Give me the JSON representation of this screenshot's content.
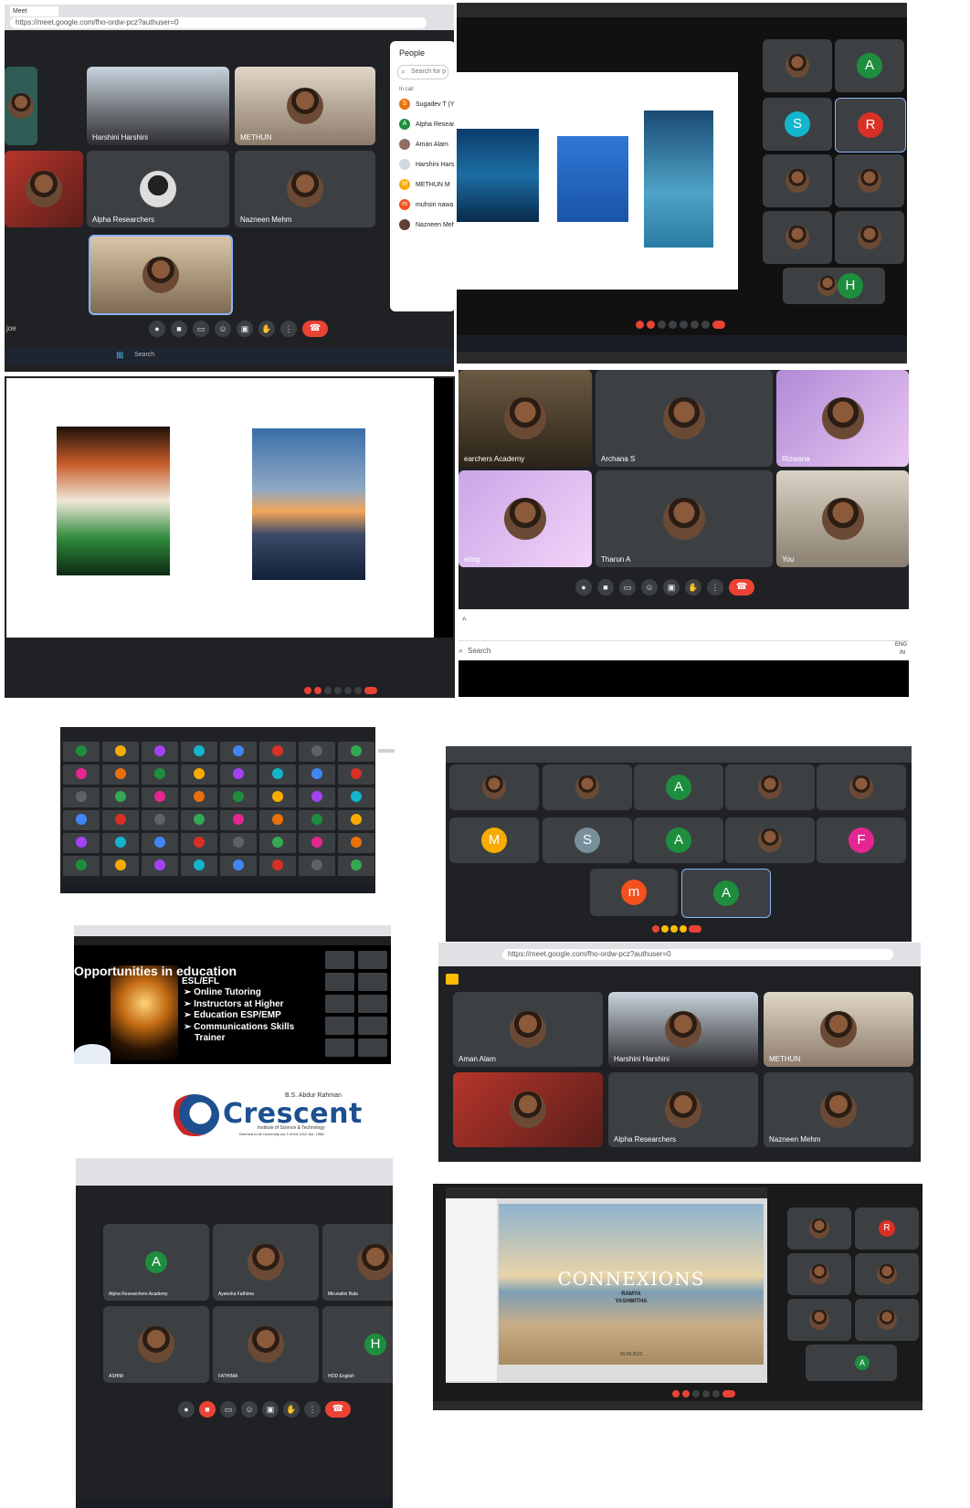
{
  "p1": {
    "tab": "Meet",
    "url": "https://meet.google.com/fho-ordw-pcz?authuser=0",
    "tiles": [
      {
        "name": ""
      },
      {
        "name": "Harshini Harshini"
      },
      {
        "name": "METHUN"
      },
      {
        "name": ""
      },
      {
        "name": "Alpha Researchers"
      },
      {
        "name": "Nazneen Mehm"
      },
      {
        "name": ""
      }
    ],
    "people": {
      "title": "People",
      "search": "Search for p",
      "in_call": "In call",
      "list": [
        {
          "initial": "S",
          "name": "Sugadev T (Y",
          "color": "#e8710a"
        },
        {
          "initial": "A",
          "name": "Alpha Resear",
          "color": "#1e8e3e"
        },
        {
          "initial": "",
          "name": "Aman Alam",
          "color": "#8d6e63"
        },
        {
          "initial": "",
          "name": "Harshini Hars",
          "color": "#cfd8dc"
        },
        {
          "initial": "M",
          "name": "METHUN M",
          "color": "#f9ab00"
        },
        {
          "initial": "m",
          "name": "muhsin nawa",
          "color": "#f4511e"
        },
        {
          "initial": "",
          "name": "Nazneen Meh",
          "color": "#5d4037"
        }
      ]
    },
    "bottom_left": "joe",
    "taskbar_search": "Search"
  },
  "p2": {
    "tiles": [
      {
        "name": "",
        "avatar": "",
        "color": ""
      },
      {
        "name": "",
        "avatar": "A",
        "color": "#1e8e3e"
      },
      {
        "name": "",
        "avatar": "S",
        "color": "#12b5cb"
      },
      {
        "name": "",
        "avatar": "R",
        "color": "#d93025"
      },
      {
        "name": "",
        "avatar": "",
        "color": ""
      },
      {
        "name": "",
        "avatar": "",
        "color": ""
      },
      {
        "name": "",
        "avatar": "",
        "color": ""
      },
      {
        "name": "",
        "avatar": "",
        "color": ""
      }
    ],
    "bottom_tile_avatar": "H"
  },
  "p3": {},
  "p4": {
    "tiles": [
      {
        "name": "earchers Academy"
      },
      {
        "name": "Archana S"
      },
      {
        "name": "Rizwana"
      },
      {
        "name": "eting"
      },
      {
        "name": "Tharun A"
      },
      {
        "name": "You"
      }
    ],
    "taskbar_search": "Search",
    "lang": "ENG",
    "lang2": "IN"
  },
  "p5": {},
  "p6": {
    "row1": [
      {
        "avatar": "",
        "color": ""
      },
      {
        "avatar": "",
        "color": ""
      },
      {
        "avatar": "A",
        "color": "#1e8e3e"
      },
      {
        "avatar": "",
        "color": ""
      },
      {
        "avatar": "",
        "color": ""
      }
    ],
    "row2": [
      {
        "avatar": "M",
        "color": "#f9ab00"
      },
      {
        "avatar": "S",
        "color": "#78909c"
      },
      {
        "avatar": "A",
        "color": "#1e8e3e"
      },
      {
        "avatar": "",
        "color": ""
      },
      {
        "avatar": "F",
        "color": "#e52592"
      }
    ],
    "row3": [
      {
        "avatar": "m",
        "color": "#f4511e"
      },
      {
        "avatar": "A",
        "color": "#1e8e3e"
      }
    ]
  },
  "p7": {
    "heading": "Opportunities in education",
    "sub": "ESL/EFL",
    "bullets": [
      "Online Tutoring",
      "Instructors at Higher",
      "Education ESP/EMP",
      "Communications Skills",
      "Trainer"
    ]
  },
  "logo": {
    "top": "B.S. Abdur Rahman",
    "name": "Crescent",
    "tagline": "Institute of Science & Technology",
    "tagline2": "Deemed to be University u/s 3 of the UGC Act, 1956"
  },
  "p8": {
    "url": "https://meet.google.com/fho-ordw-pcz?authuser=0",
    "tiles": [
      {
        "name": "Aman Alam"
      },
      {
        "name": "Harshini Harshini"
      },
      {
        "name": "METHUN"
      },
      {
        "name": ""
      },
      {
        "name": "Alpha Researchers"
      },
      {
        "name": "Nazneen Mehm"
      }
    ]
  },
  "p9": {
    "tiles": [
      {
        "name": "Alpha Researchers Academy",
        "avatar": "A",
        "color": "#1e8e3e"
      },
      {
        "name": "Ayeesha Fathima",
        "avatar": "",
        "color": ""
      },
      {
        "name": "Mirunalini Bala",
        "avatar": "",
        "color": ""
      },
      {
        "name": "ASHIM",
        "avatar": "",
        "color": ""
      },
      {
        "name": "FATHIMA",
        "avatar": "",
        "color": ""
      },
      {
        "name": "HOD English",
        "avatar": "H",
        "color": "#1e8e3e"
      }
    ]
  },
  "p10": {
    "title": "CONNEXIONS",
    "line1": "RAMYA",
    "line2": "YASHMITHA",
    "date": "16.09.2022",
    "side_avatar": "R",
    "side_avatar2": "A"
  },
  "icons": {
    "mic": "mic-icon",
    "cam": "camera-icon",
    "cc": "captions-icon",
    "emoji": "emoji-icon",
    "present": "present-icon",
    "hand": "hand-icon",
    "more": "more-icon",
    "end": "end-call-icon"
  }
}
